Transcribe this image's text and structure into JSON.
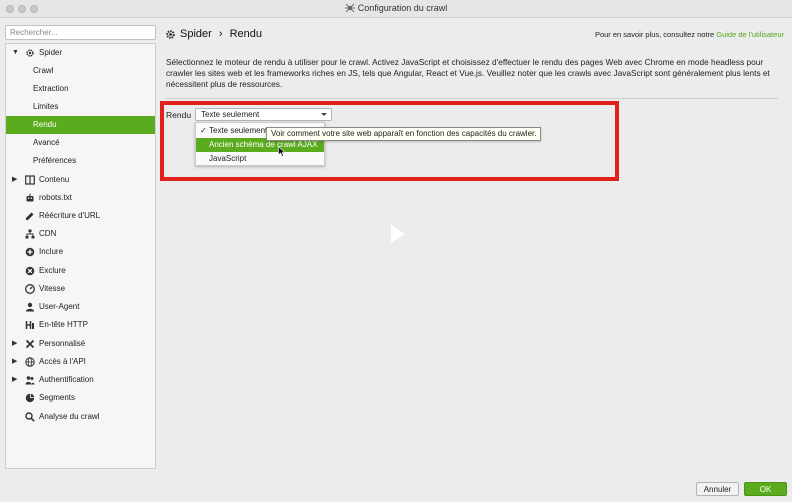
{
  "window": {
    "title": "Configuration du crawl"
  },
  "sidebar": {
    "search_placeholder": "Rechercher...",
    "items": [
      {
        "label": "Spider",
        "icon": "gear-icon",
        "arrow": "▼"
      },
      {
        "label": "Crawl"
      },
      {
        "label": "Extraction"
      },
      {
        "label": "Limites"
      },
      {
        "label": "Rendu"
      },
      {
        "label": "Avancé"
      },
      {
        "label": "Préférences"
      },
      {
        "label": "Contenu",
        "icon": "columns-icon",
        "arrow": "▶"
      },
      {
        "label": "robots.txt",
        "icon": "robot-icon"
      },
      {
        "label": "Réécriture d'URL",
        "icon": "rewrite-icon"
      },
      {
        "label": "CDN",
        "icon": "network-icon"
      },
      {
        "label": "Inclure",
        "icon": "plus-circle-icon"
      },
      {
        "label": "Exclure",
        "icon": "x-circle-icon"
      },
      {
        "label": "Vitesse",
        "icon": "speed-icon"
      },
      {
        "label": "User-Agent",
        "icon": "user-agent-icon"
      },
      {
        "label": "En-tête HTTP",
        "icon": "header-icon"
      },
      {
        "label": "Personnalisé",
        "icon": "tools-icon",
        "arrow": "▶"
      },
      {
        "label": "Accès à l'API",
        "icon": "globe-icon",
        "arrow": "▶"
      },
      {
        "label": "Authentification",
        "icon": "users-icon",
        "arrow": "▶"
      },
      {
        "label": "Segments",
        "icon": "pie-icon"
      },
      {
        "label": "Analyse du crawl",
        "icon": "search-icon"
      }
    ]
  },
  "header": {
    "section": "Spider",
    "separator": "›",
    "page": "Rendu",
    "help_prefix": "Pour en savoir plus, consultez notre",
    "help_link": "Guide de l'utilisateur"
  },
  "description": "Sélectionnez le moteur de rendu à utiliser pour le crawl. Activez JavaScript et choisissez d'effectuer le rendu des pages Web avec Chrome en mode headless pour crawler les sites web et les frameworks riches en JS, tels que Angular, React et Vue.js. Veuillez noter que les crawls avec JavaScript sont généralement plus lents et nécessitent plus de ressources.",
  "render": {
    "label": "Rendu",
    "selected": "Texte seulement",
    "options": [
      "Texte seulement",
      "Ancien schéma de crawl AJAX",
      "JavaScript"
    ],
    "check": "✓",
    "tooltip": "Voir comment votre site web apparaît en fonction des capacités du crawler."
  },
  "footer": {
    "cancel": "Annuler",
    "ok": "OK"
  },
  "colors": {
    "accent": "#5aac1e",
    "highlight_box": "#e0211c"
  }
}
